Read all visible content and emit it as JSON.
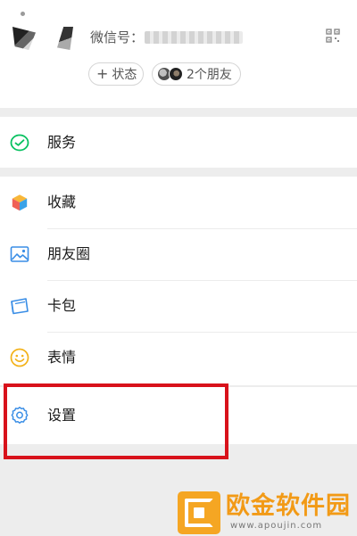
{
  "profile": {
    "wechat_id_prefix": "微信号：",
    "status_button_label": "状态",
    "friends_label": "2个朋友"
  },
  "menu": {
    "service": {
      "label": "服务",
      "icon": "service-icon"
    },
    "favorites": {
      "label": "收藏",
      "icon": "favorites-cube-icon"
    },
    "moments": {
      "label": "朋友圈",
      "icon": "moments-photo-icon"
    },
    "cards": {
      "label": "卡包",
      "icon": "wallet-card-icon"
    },
    "stickers": {
      "label": "表情",
      "icon": "smiley-icon"
    },
    "settings": {
      "label": "设置",
      "icon": "gear-icon"
    }
  },
  "highlight": {
    "target": "settings",
    "color": "#d8121b"
  },
  "watermark": {
    "brand": "欧金软件园",
    "url": "www.apoujin.com",
    "color": "#f29a16"
  },
  "colors": {
    "background": "#ededed",
    "wechat_green": "#07c160",
    "icon_blue": "#3a8ee6"
  }
}
